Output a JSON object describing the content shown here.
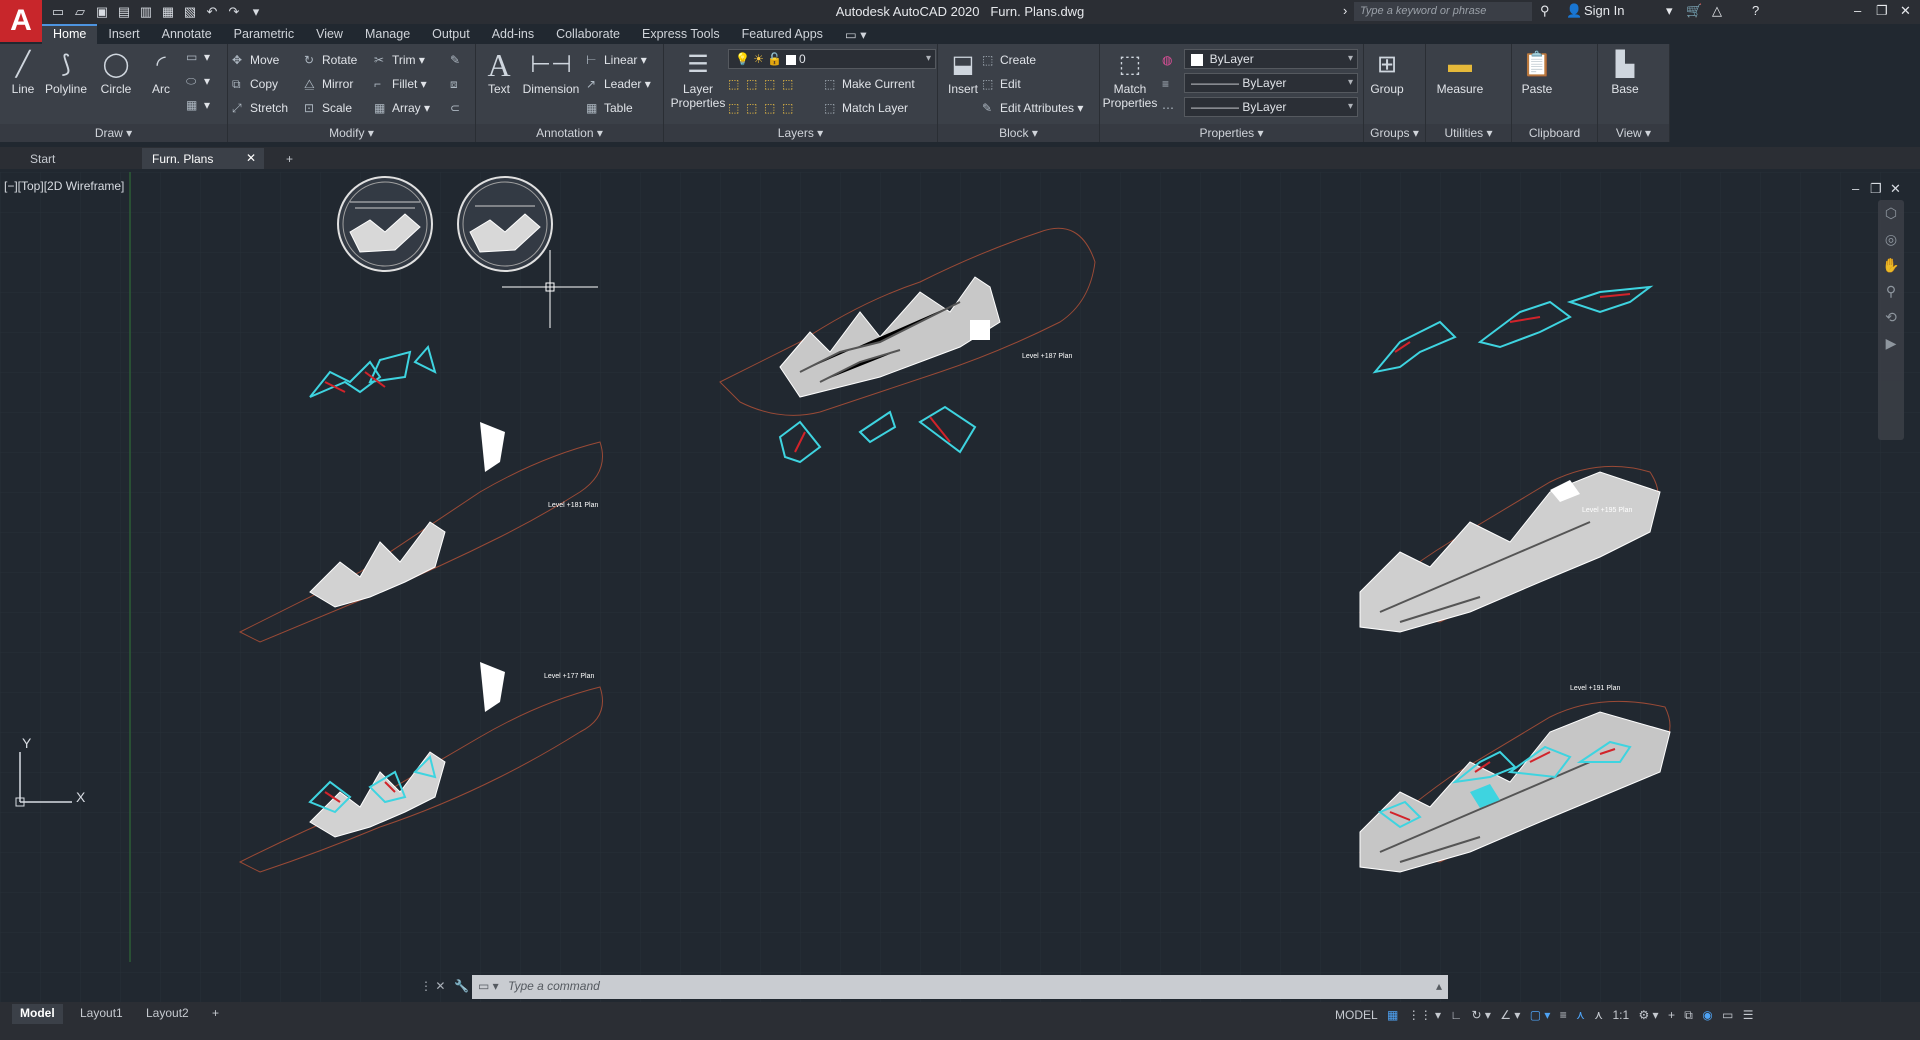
{
  "app": {
    "logo_letter": "A",
    "title": "Autodesk AutoCAD 2020",
    "filename": "Furn. Plans.dwg",
    "search_placeholder": "Type a keyword or phrase",
    "sign_in": "Sign In"
  },
  "menu": [
    "Home",
    "Insert",
    "Annotate",
    "Parametric",
    "View",
    "Manage",
    "Output",
    "Add-ins",
    "Collaborate",
    "Express Tools",
    "Featured Apps"
  ],
  "ribbon": {
    "draw": {
      "title": "Draw",
      "line": "Line",
      "polyline": "Polyline",
      "circle": "Circle",
      "arc": "Arc"
    },
    "modify": {
      "title": "Modify",
      "move": "Move",
      "rotate": "Rotate",
      "trim": "Trim",
      "copy": "Copy",
      "mirror": "Mirror",
      "fillet": "Fillet",
      "stretch": "Stretch",
      "scale": "Scale",
      "array": "Array"
    },
    "annotation": {
      "title": "Annotation",
      "text": "Text",
      "dimension": "Dimension",
      "linear": "Linear",
      "leader": "Leader",
      "table": "Table"
    },
    "layers": {
      "title": "Layers",
      "layer_properties_1": "Layer",
      "layer_properties_2": "Properties",
      "current_layer": "0",
      "make_current": "Make Current",
      "match_layer": "Match Layer"
    },
    "block": {
      "title": "Block",
      "insert": "Insert",
      "create": "Create",
      "edit": "Edit",
      "edit_attributes": "Edit Attributes"
    },
    "properties": {
      "title": "Properties",
      "match_1": "Match",
      "match_2": "Properties",
      "color": "ByLayer",
      "lineweight": "ByLayer",
      "linetype": "ByLayer"
    },
    "groups": {
      "title": "Groups",
      "group": "Group"
    },
    "utilities": {
      "title": "Utilities",
      "measure": "Measure"
    },
    "clipboard": {
      "title": "Clipboard",
      "paste": "Paste"
    },
    "view": {
      "title": "View",
      "base": "Base"
    }
  },
  "doc_tabs": {
    "start": "Start",
    "current": "Furn. Plans"
  },
  "viewport_label": "[−][Top][2D Wireframe]",
  "drawing_labels": {
    "l187": "Level +187 Plan",
    "l181": "Level +181 Plan",
    "l177": "Level +177 Plan",
    "l195": "Level +195 Plan",
    "l191": "Level +191 Plan"
  },
  "ucs": {
    "x": "X",
    "y": "Y"
  },
  "command_placeholder": "Type a command",
  "layout_tabs": [
    "Model",
    "Layout1",
    "Layout2"
  ],
  "status": {
    "model": "MODEL",
    "scale": "1:1"
  },
  "colors": {
    "accent": "#4d94e0",
    "cyan": "#3ed4e0",
    "red": "#d2232a",
    "terrain": "#9a4a36",
    "background": "#212830"
  }
}
